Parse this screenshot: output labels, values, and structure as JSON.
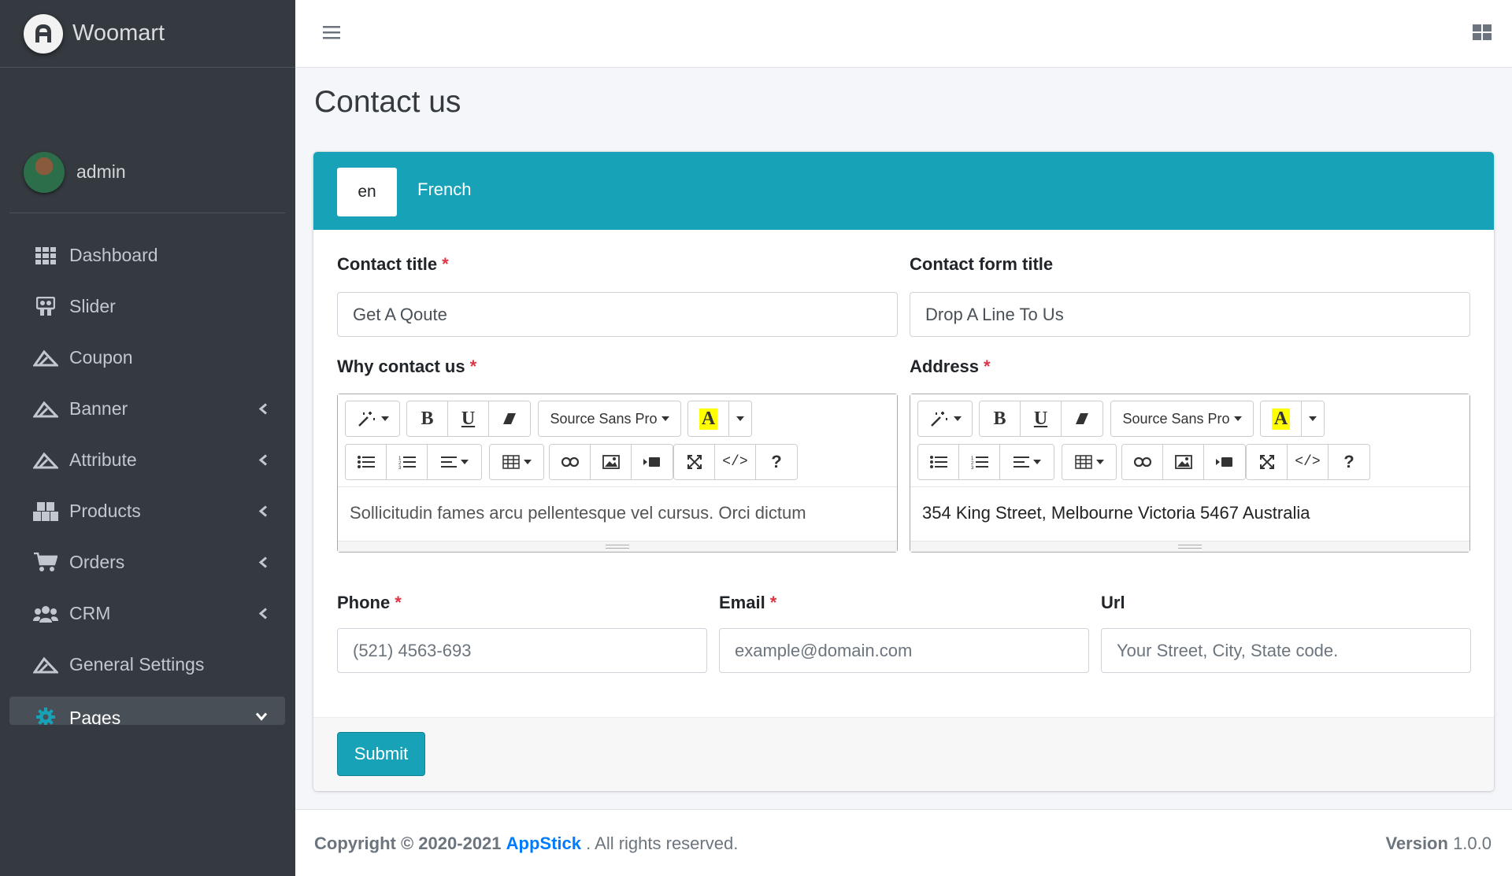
{
  "brand": {
    "name": "Woomart"
  },
  "user": {
    "name": "admin"
  },
  "sidebar": {
    "items": [
      {
        "label": "Dashboard",
        "icon": "grid-icon",
        "chevron": false
      },
      {
        "label": "Slider",
        "icon": "slideshare-icon",
        "chevron": false
      },
      {
        "label": "Coupon",
        "icon": "mountain-icon",
        "chevron": false
      },
      {
        "label": "Banner",
        "icon": "mountain-icon",
        "chevron": "left"
      },
      {
        "label": "Attribute",
        "icon": "mountain-icon",
        "chevron": "left"
      },
      {
        "label": "Products",
        "icon": "boxes-icon",
        "chevron": "left"
      },
      {
        "label": "Orders",
        "icon": "cart-icon",
        "chevron": "left"
      },
      {
        "label": "CRM",
        "icon": "users-icon",
        "chevron": "left"
      },
      {
        "label": "General Settings",
        "icon": "mountain-icon",
        "chevron": false
      },
      {
        "label": "Pages",
        "icon": "cog-icon",
        "chevron": "down"
      }
    ]
  },
  "page": {
    "title": "Contact us"
  },
  "tabs": {
    "active": "en",
    "other": "French"
  },
  "form": {
    "contact_title": {
      "label": "Contact title",
      "required": "*",
      "value": "Get A Qoute"
    },
    "contact_form_title": {
      "label": "Contact form title",
      "value": "Drop A Line To Us"
    },
    "why_contact": {
      "label": "Why contact us",
      "required": "*",
      "content": "Sollicitudin fames arcu pellentesque vel cursus. Orci dictum"
    },
    "address": {
      "label": "Address",
      "required": "*",
      "content": "354 King Street, Melbourne Victoria 5467 Australia"
    },
    "phone": {
      "label": "Phone",
      "required": "*",
      "placeholder": "(521) 4563-693"
    },
    "email": {
      "label": "Email",
      "required": "*",
      "placeholder": "example@domain.com"
    },
    "url": {
      "label": "Url",
      "placeholder": "Your Street, City, State code."
    },
    "submit": "Submit"
  },
  "editor": {
    "font_name": "Source Sans Pro",
    "bold": "B",
    "underline": "U",
    "highlight": "A",
    "code": "</>",
    "help": "?"
  },
  "footer": {
    "copyright_prefix": "Copyright © 2020-2021",
    "company": "AppStick",
    "suffix": ". All rights reserved.",
    "version_label": "Version",
    "version_value": "1.0.0"
  },
  "colors": {
    "accent": "#17a2b8",
    "sidebar": "#343a40",
    "required": "#dc3545",
    "link": "#007bff"
  }
}
